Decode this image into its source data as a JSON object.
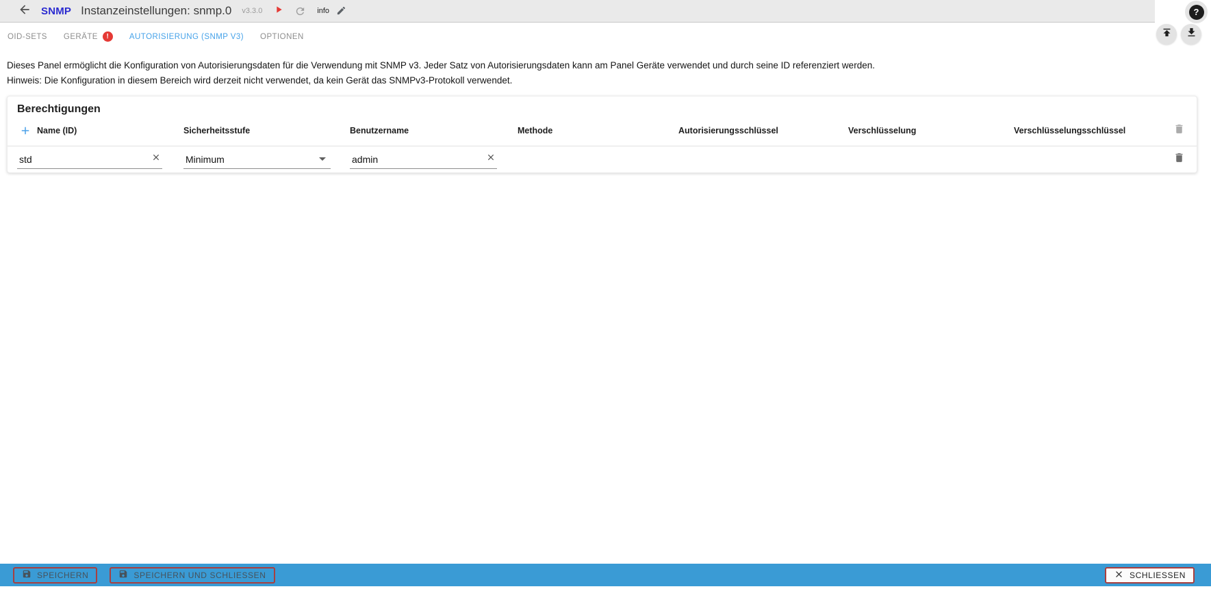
{
  "header": {
    "logo": "SNMP",
    "title": "Instanzeinstellungen: snmp.0",
    "version": "v3.3.0",
    "info_label": "info",
    "help_label": "?"
  },
  "tabs": {
    "oid_sets": "OID-SETS",
    "geraete": "GERÄTE",
    "geraete_badge": "!",
    "autorisierung": "AUTORISIERUNG (SNMP V3)",
    "optionen": "OPTIONEN"
  },
  "description": {
    "line1": "Dieses Panel ermöglicht die Konfiguration von Autorisierungsdaten für die Verwendung mit SNMP v3. Jeder Satz von Autorisierungsdaten kann am Panel Geräte verwendet und durch seine ID referenziert werden.",
    "line2": "Hinweis: Die Konfiguration in diesem Bereich wird derzeit nicht verwendet, da kein Gerät das SNMPv3-Protokoll verwendet."
  },
  "panel": {
    "title": "Berechtigungen",
    "columns": [
      "Name (ID)",
      "Sicherheitsstufe",
      "Benutzername",
      "Methode",
      "Autorisierungsschlüssel",
      "Verschlüsselung",
      "Verschlüsselungsschlüssel"
    ],
    "row": {
      "name": "std",
      "security_level": "Minimum",
      "username": "admin"
    }
  },
  "footer": {
    "save": "SPEICHERN",
    "save_and_close": "SPEICHERN UND SCHLIESSEN",
    "close": "SCHLIESSEN"
  },
  "colors": {
    "logo_blue": "#2a2ad0",
    "active_tab_blue": "#45a2e9",
    "badge_red": "#e53935",
    "toolbar_blue": "#3a9bd5",
    "button_outline_red": "#a83f3f"
  }
}
